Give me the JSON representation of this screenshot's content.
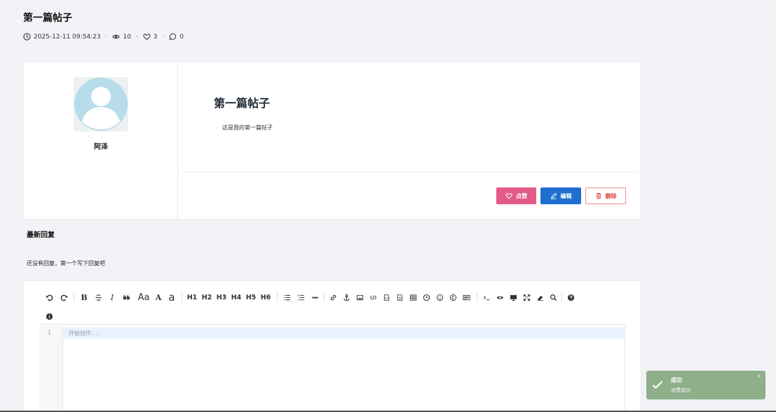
{
  "post": {
    "title": "第一篇帖子",
    "datetime": "2025-12-11 09:54:23",
    "views": "10",
    "likes": "3",
    "comments": "0",
    "author": "阿泽",
    "content_title": "第一篇帖子",
    "content_body": "这是我的第一篇帖子"
  },
  "actions": {
    "like": "点赞",
    "edit": "编辑",
    "delete": "删除"
  },
  "replies": {
    "title": "最新回复",
    "empty": "还没有回复，第一个写下回复吧"
  },
  "editor": {
    "line_number": "1",
    "placeholder": "开始创作...",
    "toolbar": {
      "bold": "B",
      "italic": "I",
      "font_size": "Aa",
      "font_a": "A",
      "font_a2": "a",
      "h1": "H1",
      "h2": "H2",
      "h3": "H3",
      "h4": "H4",
      "h5": "H5",
      "h6": "H6"
    }
  },
  "toast": {
    "title": "成功",
    "message": "点赞成功",
    "close": "×"
  },
  "colors": {
    "like": "#e25b86",
    "edit": "#1f6fd1",
    "delete": "#e04646",
    "toast": "#8fae8a",
    "avatar": "#b6dde9"
  }
}
